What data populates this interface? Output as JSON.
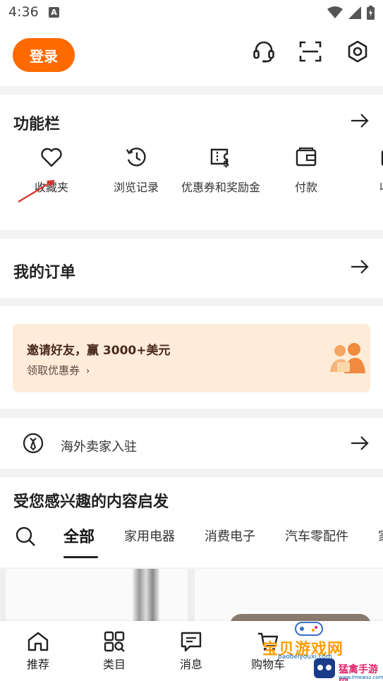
{
  "status_bar": {
    "time": "4:36",
    "notification_letter": "A"
  },
  "header": {
    "login_label": "登录",
    "icons": [
      "headset-icon",
      "scan-icon",
      "settings-icon"
    ],
    "accent_color": "#ff6a00"
  },
  "function_bar": {
    "title": "功能栏",
    "items": [
      {
        "label": "收藏夹",
        "icon": "heart-icon"
      },
      {
        "label": "浏览记录",
        "icon": "history-icon"
      },
      {
        "label": "优惠券和奖励金",
        "icon": "coupon-icon"
      },
      {
        "label": "付款",
        "icon": "wallet-icon"
      },
      {
        "label": "收货",
        "icon": "package-icon"
      }
    ]
  },
  "orders": {
    "title": "我的订单"
  },
  "promo": {
    "title": "邀请好友，赢 3000+美元",
    "subtitle": "领取优惠券",
    "bg_color": "#feecd9"
  },
  "seller": {
    "label": "海外卖家入驻"
  },
  "interests": {
    "title": "受您感兴趣的内容启发",
    "tabs": [
      "全部",
      "家用电器",
      "消费电子",
      "汽车零配件",
      "家"
    ],
    "active_tab": 0
  },
  "bottom_nav": {
    "items": [
      {
        "label": "推荐",
        "icon": "home-icon"
      },
      {
        "label": "类目",
        "icon": "category-icon"
      },
      {
        "label": "消息",
        "icon": "message-icon"
      },
      {
        "label": "购物车",
        "icon": "cart-icon"
      }
    ]
  },
  "watermark": {
    "text": "宝贝游戏网",
    "sub": "baobeiyouxi.com",
    "text2": "猛禽手游网",
    "url": "www.lmwwsz.com"
  }
}
